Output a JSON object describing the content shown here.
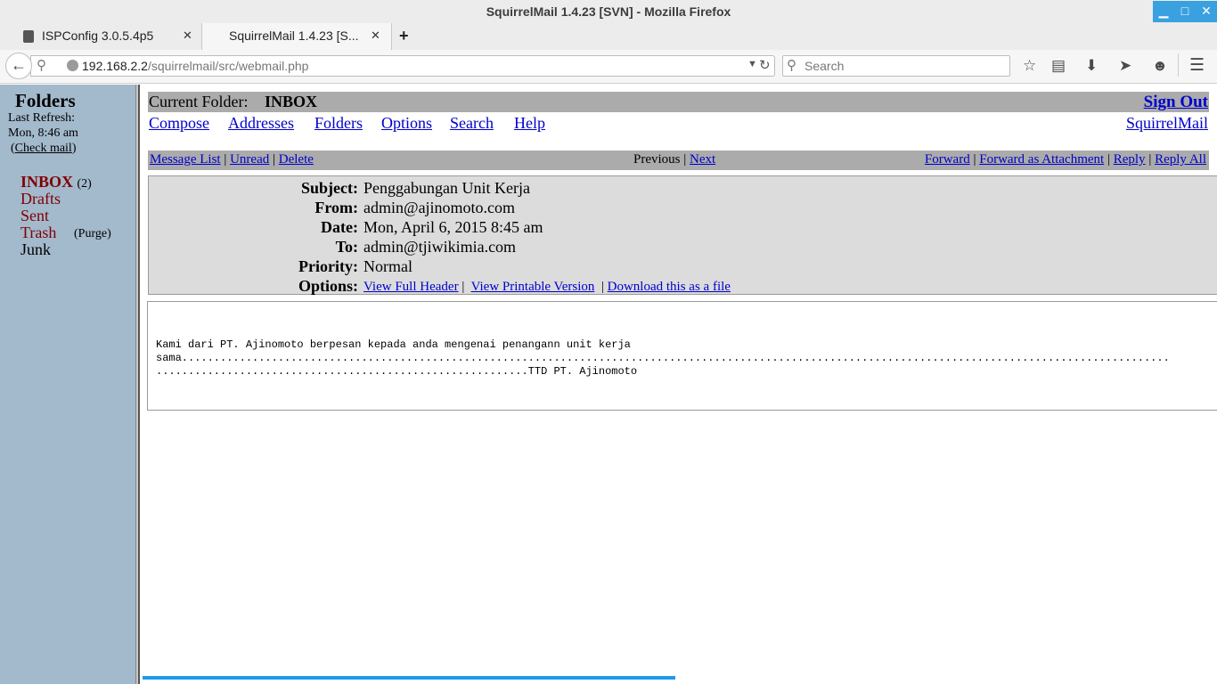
{
  "window": {
    "title": "SquirrelMail 1.4.23 [SVN] - Mozilla Firefox",
    "buttons": {
      "minimize": "▁",
      "maximize": "□",
      "close": "✕"
    }
  },
  "tabs": [
    {
      "label": "ISPConfig 3.0.5.4p5",
      "close": "✕",
      "active": false
    },
    {
      "label": "SquirrelMail 1.4.23 [S...",
      "close": "✕",
      "active": true
    }
  ],
  "new_tab": "+",
  "navbar": {
    "back": "←",
    "url_host": "192.168.2.2",
    "url_path": "/squirrelmail/src/webmail.php",
    "search_placeholder": "Search",
    "icons": [
      "bookmark-star-icon",
      "reading-list-icon",
      "download-icon",
      "send-icon",
      "chat-icon",
      "menu-icon"
    ]
  },
  "sidebar": {
    "heading": "Folders",
    "last_refresh_label": "Last Refresh:",
    "last_refresh_time": "Mon, 8:46 am",
    "check_mail_open": "(",
    "check_mail": "Check mail",
    "check_mail_close": ")",
    "folders": [
      {
        "name": "INBOX",
        "count": "(2)",
        "active": true
      },
      {
        "name": "Drafts"
      },
      {
        "name": "Sent"
      },
      {
        "name": "Trash",
        "extra": "(Purge)"
      },
      {
        "name": "Junk",
        "plain": true
      }
    ]
  },
  "main": {
    "current_folder_label": "Current Folder:",
    "current_folder": "INBOX",
    "sign_out": "Sign Out",
    "squirrelmail": "SquirrelMail",
    "menu": [
      "Compose",
      "Addresses",
      "Folders",
      "Options",
      "Search",
      "Help"
    ],
    "msg_actions_left": [
      "Message List",
      "Unread",
      "Delete"
    ],
    "previous": "Previous",
    "next": "Next",
    "msg_actions_right": [
      "Forward",
      "Forward as Attachment",
      "Reply",
      "Reply All"
    ]
  },
  "message": {
    "labels": {
      "subject": "Subject:",
      "from": "From:",
      "date": "Date:",
      "to": "To:",
      "priority": "Priority:",
      "options": "Options:"
    },
    "subject": "Penggabungan Unit Kerja",
    "from": "admin@ajinomoto.com",
    "date": "Mon, April 6, 2015 8:45 am",
    "to": "admin@tjiwikimia.com",
    "priority": "Normal",
    "options": [
      "View Full Header",
      "View Printable Version",
      "Download this as a file"
    ],
    "body": "Kami dari PT. Ajinomoto berpesan kepada anda mengenai penangann unit kerja\nsama..........................................................................................................................................................\n..........................................................TTD PT. Ajinomoto"
  },
  "colors": {
    "sidebar_bg": "#a3b9cc",
    "link": "#0000cc",
    "folder_link": "#800000",
    "bar_gray": "#ababab",
    "header_bg": "#dcdcdc",
    "accent": "#3aa1e0"
  }
}
